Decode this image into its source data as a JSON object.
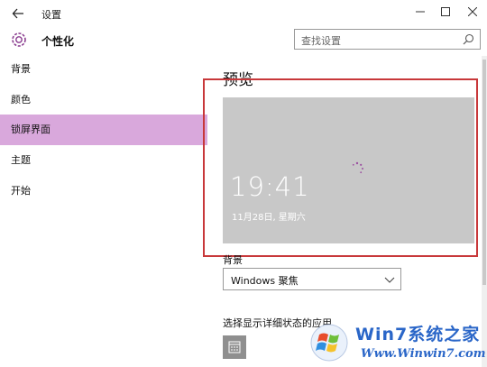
{
  "window": {
    "title": "设置",
    "back_icon": "back-arrow-icon",
    "minimize_icon": "minimize-icon",
    "maximize_icon": "maximize-icon",
    "close_icon": "close-icon"
  },
  "header": {
    "icon": "gear-icon",
    "title": "个性化",
    "search_placeholder": "查找设置",
    "search_icon": "search-icon"
  },
  "sidebar": {
    "items": [
      {
        "label": "背景",
        "selected": false
      },
      {
        "label": "颜色",
        "selected": false
      },
      {
        "label": "锁屏界面",
        "selected": true
      },
      {
        "label": "主题",
        "selected": false
      },
      {
        "label": "开始",
        "selected": false
      }
    ]
  },
  "main": {
    "title": "预览",
    "preview": {
      "time": "19:41",
      "date": "11月28日, 星期六"
    },
    "background_label": "背景",
    "background_value": "Windows 聚焦",
    "detail_apps_label": "选择显示详细状态的应用",
    "detail_app_icon": "calendar-icon"
  },
  "watermark": {
    "brand": "Win7系统之家",
    "url": "Www.Winwin7.com"
  },
  "colors": {
    "selected_nav": "#d9a8dc",
    "highlight_frame": "#c8383a",
    "preview_bg": "#c8c8c8",
    "watermark_blue": "#2a66c8"
  }
}
